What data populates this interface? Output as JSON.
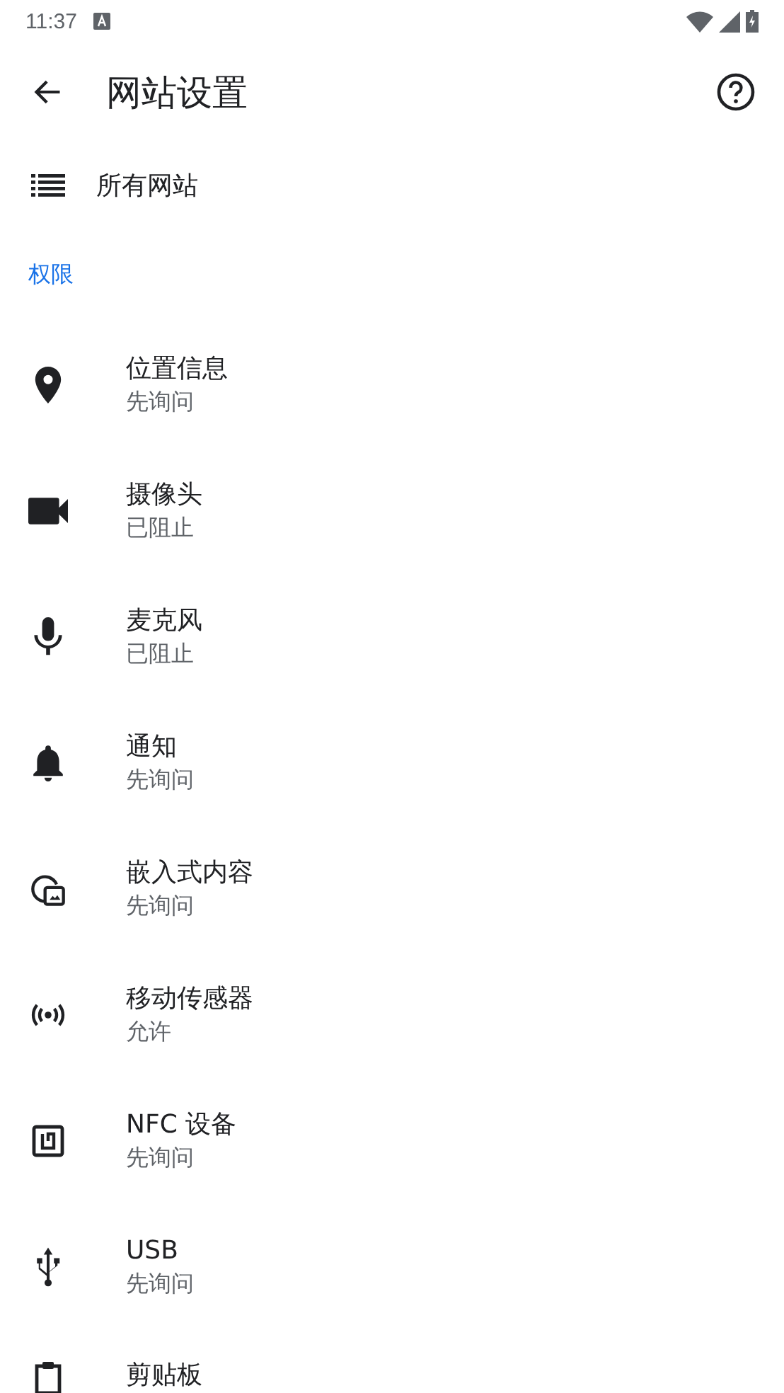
{
  "status_bar": {
    "time": "11:37"
  },
  "toolbar": {
    "title": "网站设置"
  },
  "all_sites": {
    "label": "所有网站"
  },
  "section": {
    "title": "权限"
  },
  "permissions": [
    {
      "kind": "location",
      "title": "位置信息",
      "status": "先询问"
    },
    {
      "kind": "camera",
      "title": "摄像头",
      "status": "已阻止"
    },
    {
      "kind": "microphone",
      "title": "麦克风",
      "status": "已阻止"
    },
    {
      "kind": "notifications",
      "title": "通知",
      "status": "先询问"
    },
    {
      "kind": "embedded",
      "title": "嵌入式内容",
      "status": "先询问"
    },
    {
      "kind": "sensors",
      "title": "移动传感器",
      "status": "允许"
    },
    {
      "kind": "nfc",
      "title": "NFC 设备",
      "status": "先询问"
    },
    {
      "kind": "usb",
      "title": "USB",
      "status": "先询问"
    },
    {
      "kind": "clipboard",
      "title": "剪贴板"
    }
  ]
}
